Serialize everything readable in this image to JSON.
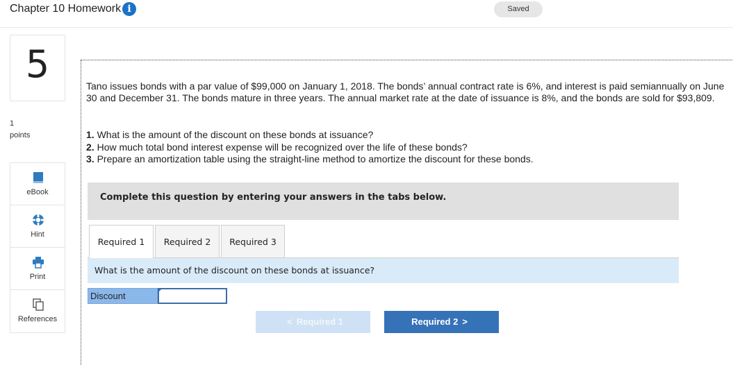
{
  "header": {
    "title": "Chapter 10 Homework",
    "info_icon": "info-icon",
    "saved_label": "Saved"
  },
  "question": {
    "number": "5",
    "points_value": "1",
    "points_label": "points"
  },
  "tools": [
    {
      "label": "eBook",
      "icon": "book-icon"
    },
    {
      "label": "Hint",
      "icon": "lifebuoy-icon"
    },
    {
      "label": "Print",
      "icon": "printer-icon"
    },
    {
      "label": "References",
      "icon": "copy-icon"
    }
  ],
  "problem": {
    "text": "Tano issues bonds with a par value of $99,000 on January 1, 2018. The bonds’ annual contract rate is 6%, and interest is paid semiannually on June 30 and December 31. The bonds mature in three years. The annual market rate at the date of issuance is 8%, and the bonds are sold for $93,809.",
    "questions": [
      {
        "num": "1.",
        "text": "What is the amount of the discount on these bonds at issuance?"
      },
      {
        "num": "2.",
        "text": "How much total bond interest expense will be recognized over the life of these bonds?"
      },
      {
        "num": "3.",
        "text": "Prepare an amortization table using the straight-line method to amortize the discount for these bonds."
      }
    ]
  },
  "instruction": "Complete this question by entering your answers in the tabs below.",
  "tabs": [
    {
      "label": "Required 1",
      "active": true
    },
    {
      "label": "Required 2",
      "active": false
    },
    {
      "label": "Required 3",
      "active": false
    }
  ],
  "subquestion": "What is the amount of the discount on these bonds at issuance?",
  "answer": {
    "label": "Discount",
    "value": ""
  },
  "nav": {
    "prev_label": "Required 1",
    "next_label": "Required 2",
    "prev_chevron": "<",
    "next_chevron": ">"
  },
  "colors": {
    "accent": "#3572b8",
    "info": "#1a73c7",
    "instruction_bg": "#e0e0e0",
    "subq_bg": "#d9ebf8"
  }
}
